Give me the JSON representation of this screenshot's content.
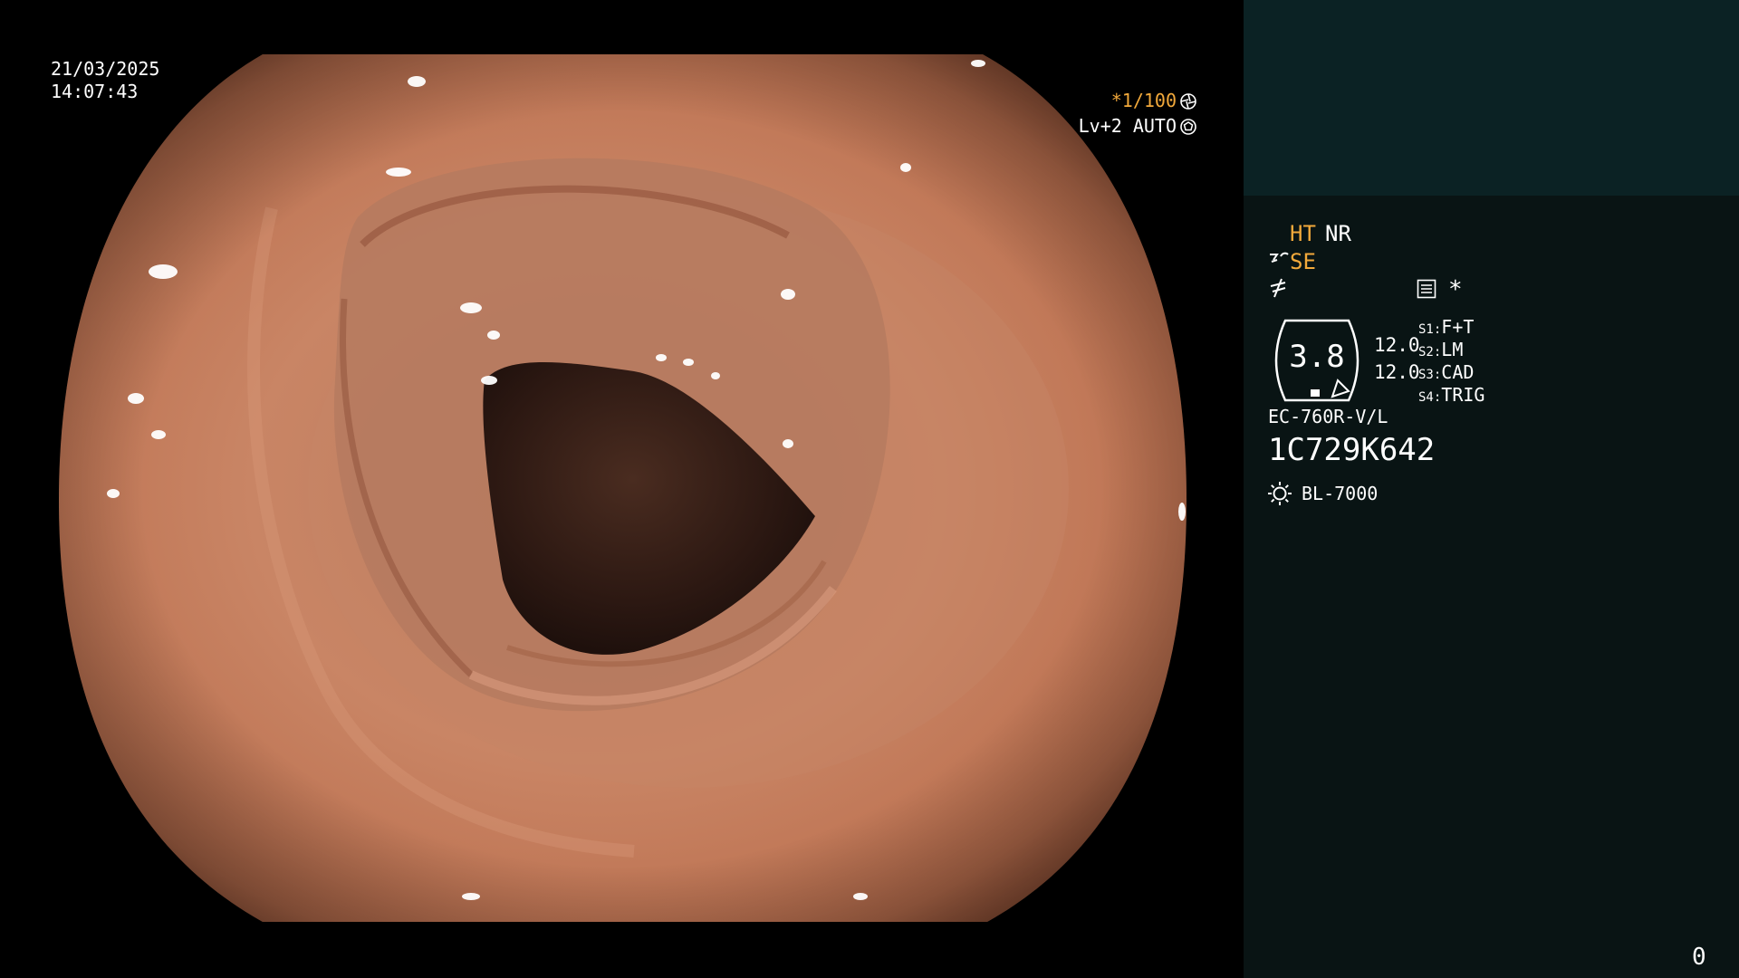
{
  "overlay": {
    "date": "21/03/2025",
    "time": "14:07:43",
    "shutter": "*1/100",
    "level": "Lv+2 AUTO",
    "shutter_icon": "aperture-icon",
    "level_icon": "iris-icon"
  },
  "status_panel": {
    "hyper_tone": "HT",
    "noise_reduction": "NR",
    "structure_enhance": "SE",
    "mode_icons": [
      "se-enhance-icon",
      "edge-enhance-icon",
      "menu-list-icon"
    ],
    "marker": "*",
    "gauge_value": "3.8",
    "pressure_1": "12.0",
    "pressure_2": "12.0",
    "switches": [
      {
        "key": "S1:",
        "value": "F+T"
      },
      {
        "key": "S2:",
        "value": "LM"
      },
      {
        "key": "S3:",
        "value": "CAD"
      },
      {
        "key": "S4:",
        "value": "TRIG"
      }
    ],
    "scope_model": "EC-760R-V/L",
    "serial_number": "1C729K642",
    "light_source": "BL-7000",
    "light_icon": "sun-icon",
    "counter": "0"
  },
  "colors": {
    "accent": "#f2a93b",
    "panel_top": "#0b2224",
    "panel_bg": "#091414"
  }
}
